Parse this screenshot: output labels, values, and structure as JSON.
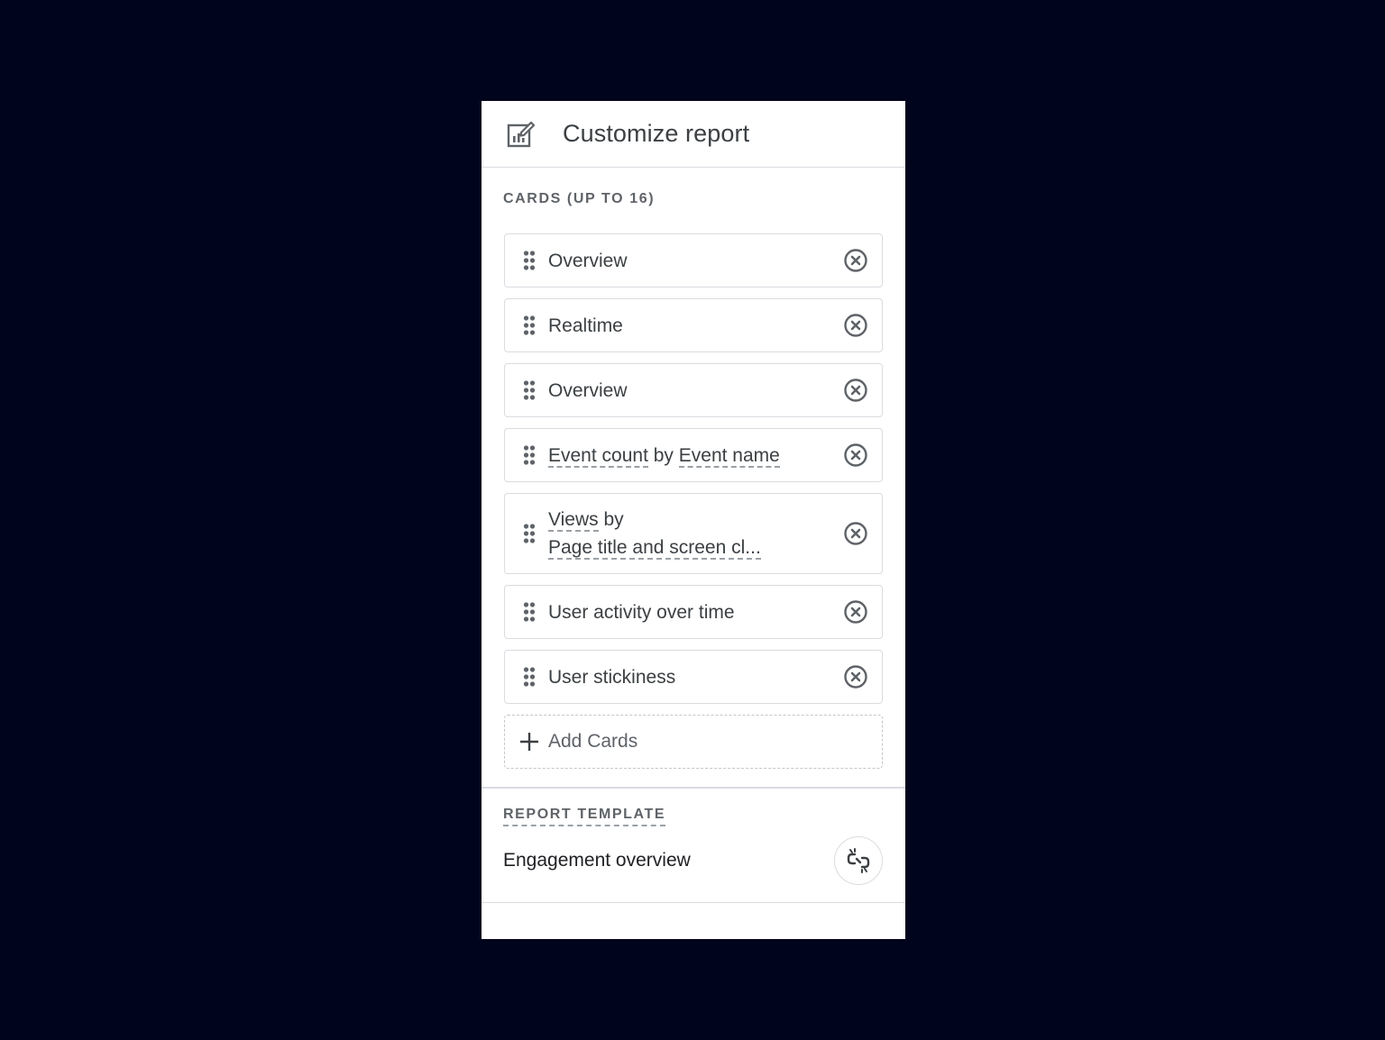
{
  "panel": {
    "title": "Customize report",
    "title_icon": "edit-report-icon"
  },
  "cards_section": {
    "label": "CARDS (UP TO 16)",
    "cards": [
      {
        "label": "Overview"
      },
      {
        "label": "Realtime"
      },
      {
        "label": "Overview"
      },
      {
        "label_part1": "Event count",
        "label_mid": " by ",
        "label_part2": "Event name"
      },
      {
        "label_line1": "Views",
        "label_line1_suffix": " by",
        "label_line2": "Page title and screen cl..."
      },
      {
        "label": "User activity over time"
      },
      {
        "label": "User stickiness"
      }
    ],
    "add_label": "Add Cards"
  },
  "template_section": {
    "label": "REPORT TEMPLATE",
    "name": "Engagement overview",
    "action_icon": "unlink-icon"
  },
  "colors": {
    "background": "#00041c",
    "panel": "#ffffff",
    "border": "#dadce0",
    "text": "#3c4043",
    "muted": "#5f6368"
  }
}
